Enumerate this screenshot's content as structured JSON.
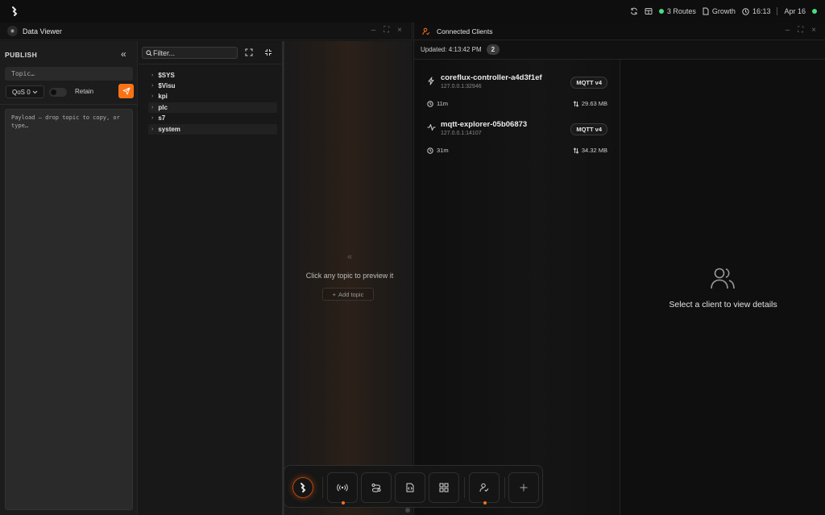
{
  "topbar": {
    "routes_label": "3 Routes",
    "growth_label": "Growth",
    "time": "16:13",
    "date": "Apr 16",
    "status_color": "#4ade80"
  },
  "data_viewer": {
    "title": "Data Viewer",
    "publish": {
      "title": "PUBLISH",
      "topic_placeholder": "Topic…",
      "qos_value": "QoS 0",
      "retain_label": "Retain",
      "retain_on": false,
      "payload_placeholder": "Payload — drop topic to copy, or type…",
      "send_color": "#f97316"
    },
    "tree": {
      "filter_placeholder": "Filter...",
      "topics": [
        {
          "label": "$SYS"
        },
        {
          "label": "$Visu"
        },
        {
          "label": "kpi"
        },
        {
          "label": "plc"
        },
        {
          "label": "s7"
        },
        {
          "label": "system"
        }
      ]
    },
    "preview": {
      "empty_text": "Click any topic to preview it",
      "add_topic_label": "Add topic"
    }
  },
  "connected_clients": {
    "title": "Connected Clients",
    "updated_label": "Updated: 4:13:42 PM",
    "count": "2",
    "clients": [
      {
        "name": "coreflux-controller-a4d3f1ef",
        "address": "127.0.0.1:32946",
        "protocol": "MQTT v4",
        "uptime": "11m",
        "traffic": "29.63 MB",
        "icon": "bolt-icon"
      },
      {
        "name": "mqtt-explorer-05b06873",
        "address": "127.0.0.1:14107",
        "protocol": "MQTT v4",
        "uptime": "31m",
        "traffic": "34.32 MB",
        "icon": "activity-icon"
      }
    ],
    "detail_empty_text": "Select a client to view details"
  },
  "dock": {
    "items": [
      "home-icon",
      "broadcast-icon",
      "routes-icon",
      "code-file-icon",
      "grid-icon",
      "user-check-icon",
      "plus-icon"
    ],
    "accent": "#f97316"
  }
}
